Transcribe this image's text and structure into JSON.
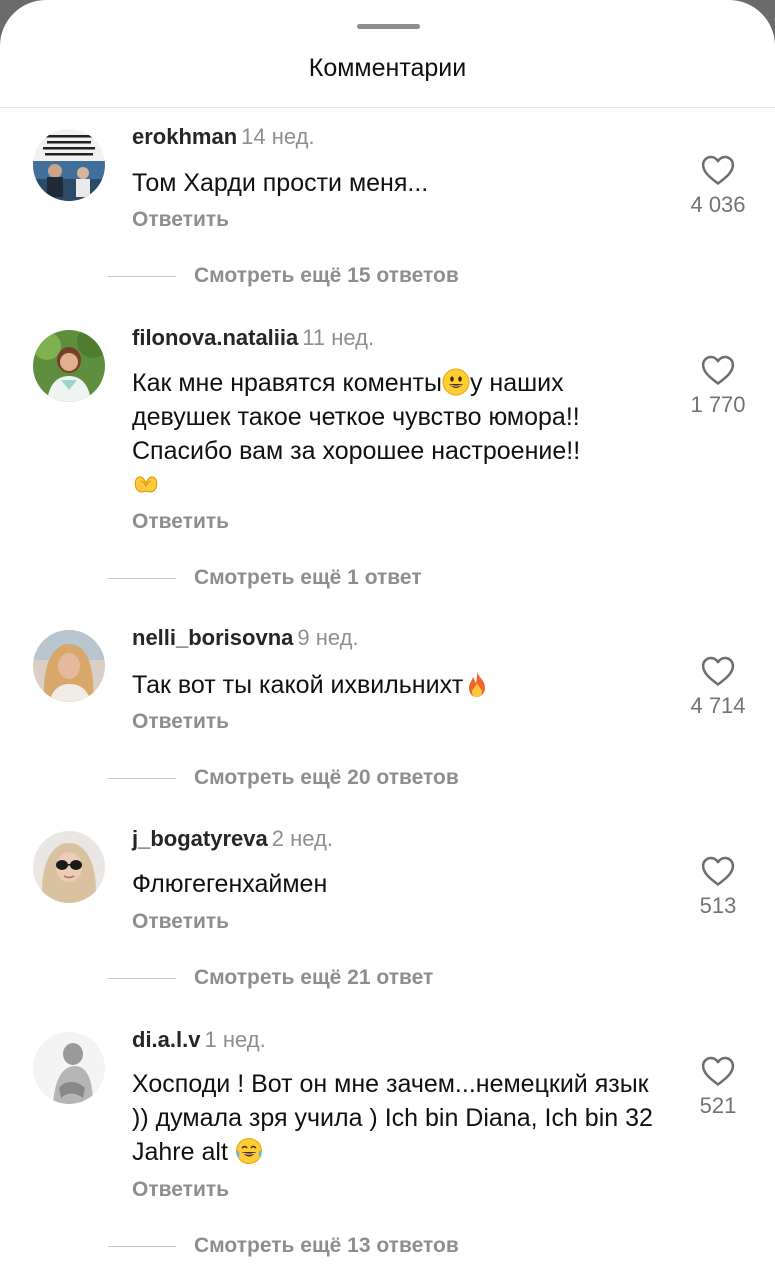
{
  "header": {
    "title": "Комментарии"
  },
  "actions": {
    "reply_label": "Ответить"
  },
  "comments": [
    {
      "username": "erokhman",
      "time": "14 нед.",
      "text": "Том Харди прости меня...",
      "likes": "4 036",
      "more_replies": "Смотреть ещё 15 ответов",
      "avatar": "meme-collage"
    },
    {
      "username": "filonova.nataliia",
      "time": "11 нед.",
      "text_part1": "Как мне нравятся коменты",
      "emoji1": "grinning-face-icon",
      "text_part2": "у наших девушек такое четкое чувство юмора!! Спасибо вам за хорошее настроение!!",
      "emoji2": "heart-hands-icon",
      "likes": "1 770",
      "more_replies": "Смотреть ещё 1 ответ",
      "avatar": "woman-green-background"
    },
    {
      "username": "nelli_borisovna",
      "time": "9 нед.",
      "text": "Так вот ты какой ихвильнихт",
      "emoji": "fire-icon",
      "likes": "4 714",
      "more_replies": "Смотреть ещё 20 ответов",
      "avatar": "blonde-woman"
    },
    {
      "username": "j_bogatyreva",
      "time": "2 нед.",
      "text": "Флюгегенхаймен",
      "likes": "513",
      "more_replies": "Смотреть ещё 21 ответ",
      "avatar": "woman-sunglasses"
    },
    {
      "username": "di.a.l.v",
      "time": "1 нед.",
      "text": "Хосподи ! Вот он мне зачем...немецкий язык )) думала зря учила )  Ich bin Diana, Ich bin 32 Jahre alt",
      "emoji": "tears-of-joy-icon",
      "likes": "521",
      "more_replies": "Смотреть ещё 13 ответов",
      "avatar": "grayscale-figure"
    }
  ],
  "colors": {
    "text_primary": "#111111",
    "text_secondary": "#8e8e8e",
    "divider": "#c7c7c7"
  }
}
